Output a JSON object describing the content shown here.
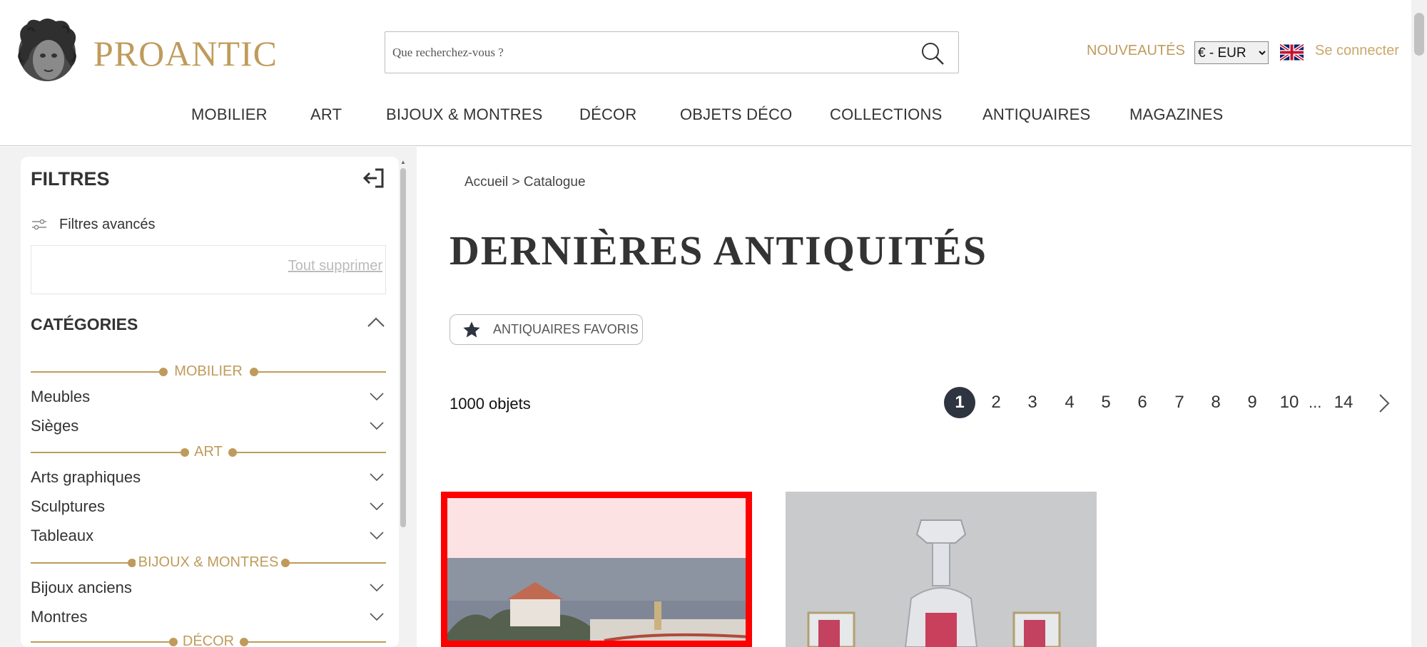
{
  "header": {
    "logo_text": "PROANTIC",
    "search_placeholder": "Que recherchez-vous ?",
    "nouveautes": "NOUVEAUTÉS",
    "currency": "€ - EUR",
    "login": "Se connecter",
    "nav": [
      "MOBILIER",
      "ART",
      "BIJOUX & MONTRES",
      "DÉCOR",
      "OBJETS DÉCO",
      "COLLECTIONS",
      "ANTIQUAIRES",
      "MAGAZINES"
    ]
  },
  "sidebar": {
    "title": "FILTRES",
    "advanced": "Filtres avancés",
    "clear_all": "Tout supprimer",
    "categories_title": "CATÉGORIES",
    "groups": [
      {
        "label": "MOBILIER",
        "items": [
          "Meubles",
          "Sièges"
        ]
      },
      {
        "label": "ART",
        "items": [
          "Arts graphiques",
          "Sculptures",
          "Tableaux"
        ]
      },
      {
        "label": "BIJOUX & MONTRES",
        "items": [
          "Bijoux anciens",
          "Montres"
        ]
      },
      {
        "label": "DÉCOR",
        "items": []
      }
    ]
  },
  "main": {
    "breadcrumb_home": "Accueil",
    "breadcrumb_sep": " > ",
    "breadcrumb_current": "Catalogue",
    "title": "DERNIÈRES ANTIQUITÉS",
    "fav_button": "ANTIQUAIRES FAVORIS",
    "count": "1000 objets",
    "pages": [
      "1",
      "2",
      "3",
      "4",
      "5",
      "6",
      "7",
      "8",
      "9",
      "10"
    ],
    "ellipsis": "...",
    "last_page": "14",
    "active_page": "1"
  },
  "colors": {
    "gold": "#bf9b5b",
    "active_page": "#2e3440",
    "highlight": "#ff0000"
  }
}
